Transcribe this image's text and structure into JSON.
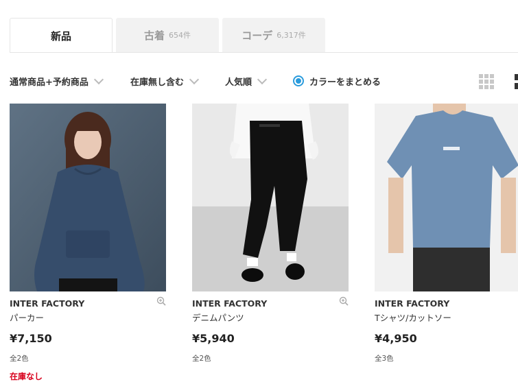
{
  "tabs": [
    {
      "label": "新品",
      "count": ""
    },
    {
      "label": "古着",
      "count": "654件"
    },
    {
      "label": "コーデ",
      "count": "6,317件"
    }
  ],
  "filters": {
    "type": "通常商品+予約商品",
    "stock": "在庫無し含む",
    "sort": "人気順",
    "color_group": "カラーをまとめる"
  },
  "products": [
    {
      "brand": "INTER FACTORY",
      "name": "パーカー",
      "price": "¥7,150",
      "colors": "全2色",
      "status": "在庫なし"
    },
    {
      "brand": "INTER FACTORY",
      "name": "デニムパンツ",
      "price": "¥5,940",
      "colors": "全2色",
      "status": ""
    },
    {
      "brand": "INTER FACTORY",
      "name": "Tシャツ/カットソー",
      "price": "¥4,950",
      "colors": "全3色",
      "status": ""
    }
  ],
  "icons": {
    "chevron": "chevron-down-icon",
    "zoom": "zoom-in-icon",
    "grid": "grid-view-icon",
    "list": "list-view-icon"
  },
  "colors": {
    "accent": "#2a9bdc",
    "soldout": "#d8001c"
  }
}
